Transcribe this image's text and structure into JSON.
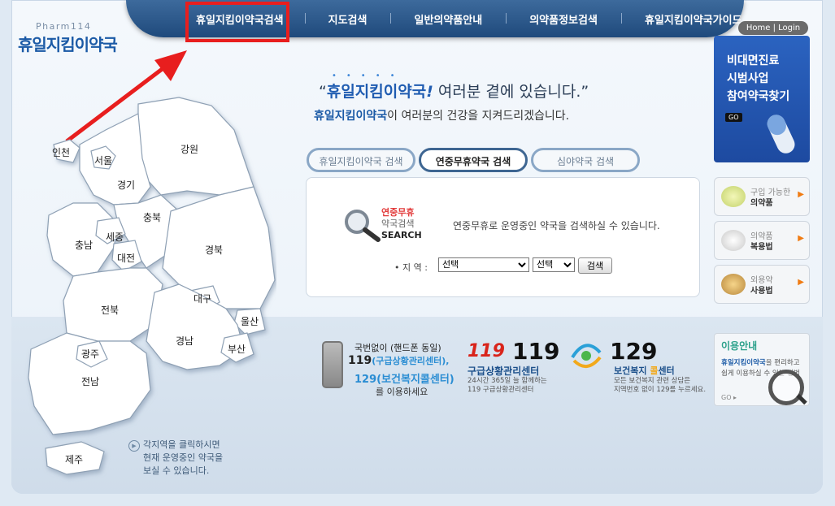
{
  "nav": {
    "items": [
      "휴일지킴이약국검색",
      "지도검색",
      "일반의약품안내",
      "의약품정보검색",
      "휴일지킴이약국가이드"
    ]
  },
  "logo": {
    "small": "Pharm114",
    "big": "휴일지킴이약국"
  },
  "header": {
    "home_login": "Home | Login"
  },
  "map": {
    "regions": [
      "인천",
      "서울",
      "경기",
      "강원",
      "충북",
      "세종",
      "충남",
      "대전",
      "경북",
      "대구",
      "울산",
      "전북",
      "경남",
      "광주",
      "부산",
      "전남",
      "제주"
    ],
    "hint": [
      "각지역을 클릭하시면",
      "현재 운영중인 약국을",
      "보실 수 있습니다."
    ]
  },
  "slogan": {
    "quote_open": "“",
    "brand": "휴일지킴이약국",
    "excl": "!",
    "rest": " 여러분 곁에 있습니다.”",
    "sub_brand": "휴일지킴이약국",
    "sub_rest": "이 여러분의 건강을 지켜드리겠습니다."
  },
  "tabs": [
    "휴일지킴이약국 검색",
    "연중무휴약국 검색",
    "심야약국 검색"
  ],
  "search": {
    "title_red": "연중무휴",
    "title_gray": "약국검색",
    "title_search": "SEARCH",
    "desc": "연중무휴로 운영중인 약국을 검색하실 수 있습니다.",
    "region_label": "• 지 역 :",
    "select1": "선택",
    "select2": "선택",
    "button": "검색"
  },
  "promo": {
    "lines": [
      "비대면진료",
      "시범사업",
      "참여약국찾기"
    ],
    "go": "GO"
  },
  "side_buttons": [
    {
      "t1": "구입 가능한",
      "t2": "의약품"
    },
    {
      "t1": "의약품",
      "t2": "복용법"
    },
    {
      "t1": "외용약",
      "t2": "사용법"
    }
  ],
  "info": {
    "phone": {
      "line1": "국번없이 (핸드폰 동일)",
      "line2_num": "119",
      "line2_rest": "(구급상황관리센터),",
      "line3": "129(보건복지콜센터)",
      "line4": "를 이용하세요"
    },
    "c119": {
      "logo": "119",
      "num": "119",
      "title": "구급상황관리센터",
      "sub": [
        "24시간 365일 늘 함께하는",
        "119 구급상황관리센터"
      ]
    },
    "c129": {
      "num": "129",
      "title_a": "보건복지 ",
      "title_b": "콜",
      "title_c": "센터",
      "sub": [
        "모든 보건복지 관련 상담은",
        "지역번호 없이 129를 누르세요."
      ]
    }
  },
  "guide": {
    "title": "이용안내",
    "brand": "휴일지킴이약국",
    "desc": "을 편리하고 쉽게 이용하실 수 있는 방법",
    "go": "GO"
  }
}
